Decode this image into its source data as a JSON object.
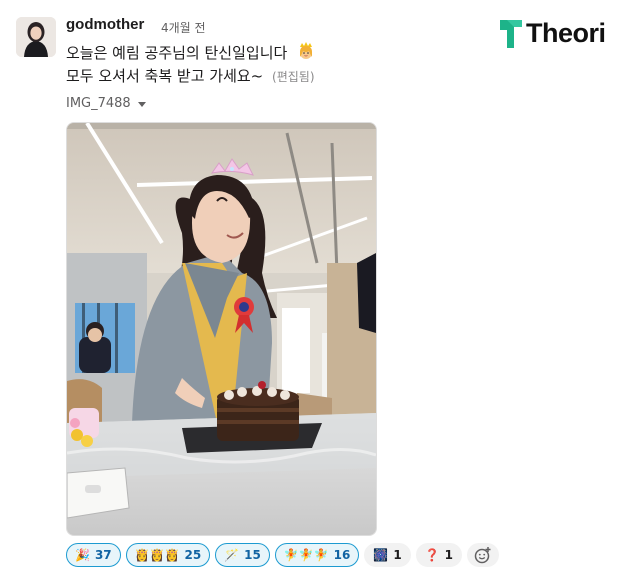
{
  "message": {
    "author": "godmother",
    "timestamp": "4개월 전",
    "line1": "오늘은 예림 공주님의 탄신일입니다",
    "line2": "모두 오셔서 축복 받고 가세요~",
    "edited": "(편집됨)"
  },
  "attachment": {
    "name": "IMG_7488"
  },
  "logo": {
    "text": "Theori",
    "color": "#1db389"
  },
  "reactions": [
    {
      "emoji": "🎉",
      "count": "37"
    },
    {
      "emoji": "👸👸👸",
      "count": "25"
    },
    {
      "emoji": "🪄",
      "count": "15"
    },
    {
      "emoji": "🧚🧚🧚",
      "count": "16"
    },
    {
      "emoji": "🎆",
      "count": "1"
    },
    {
      "emoji": "❓",
      "count": "1"
    }
  ],
  "colors": {
    "reaction_active_bg": "#e8f5fa",
    "reaction_active_border": "#1d9bd1",
    "text": "#1d1c1d"
  }
}
